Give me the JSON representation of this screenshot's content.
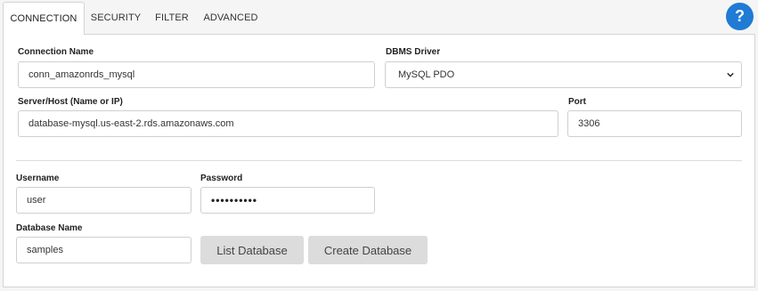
{
  "tabs": [
    {
      "label": "CONNECTION",
      "active": true
    },
    {
      "label": "SECURITY",
      "active": false
    },
    {
      "label": "FILTER",
      "active": false
    },
    {
      "label": "ADVANCED",
      "active": false
    }
  ],
  "help": {
    "label": "?",
    "icon": "help-icon",
    "color": "#1f7bd4"
  },
  "connection": {
    "connection_name_label": "Connection Name",
    "connection_name_value": "conn_amazonrds_mysql",
    "dbms_driver_label": "DBMS Driver",
    "dbms_driver_value": "MySQL PDO",
    "server_label": "Server/Host (Name or IP)",
    "server_value": "database-mysql.us-east-2.rds.amazonaws.com",
    "port_label": "Port",
    "port_value": "3306",
    "username_label": "Username",
    "username_value": "user",
    "password_label": "Password",
    "password_value": "••••••••••",
    "database_name_label": "Database Name",
    "database_name_value": "samples"
  },
  "buttons": {
    "list_database": "List Database",
    "create_database": "Create Database"
  }
}
